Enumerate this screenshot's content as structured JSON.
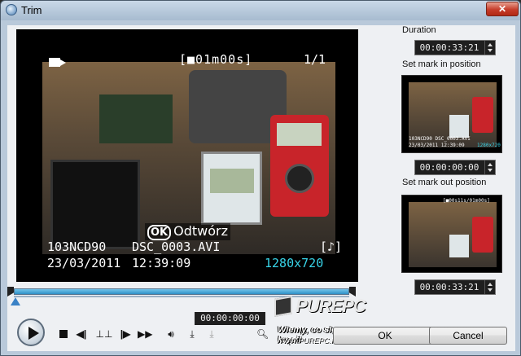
{
  "window": {
    "title": "Trim",
    "close_label": "✕"
  },
  "preview": {
    "osd_duration": "[■01m00s]",
    "osd_count": "1/1",
    "osd_play_ok": "OK",
    "osd_play_label": "Odtwórz",
    "osd_folder": "103NCD90",
    "osd_file": "DSC_0003.AVI",
    "osd_date": "23/03/2011",
    "osd_time": "12:39:09",
    "osd_note": "[♪]",
    "osd_resolution": "1280x720"
  },
  "player": {
    "timecode": "00:00:00:00",
    "progress_fraction": 0
  },
  "side_panel": {
    "duration_label": "Duration",
    "duration_value": "00:00:33:21",
    "mark_in_label": "Set mark in position",
    "mark_in_value": "00:00:00:00",
    "mark_out_label": "Set mark out position",
    "mark_out_value": "00:00:33:21",
    "thumb_in": {
      "osd_line1": "103NCD90  DSC_0003.AVI",
      "osd_line2": "23/03/2011  12:39:09",
      "osd_res": "1280x720"
    },
    "thumb_out": {
      "osd_top": "[■00s11s/01m00s]"
    }
  },
  "buttons": {
    "ok_label": "OK",
    "cancel_label": "Cancel"
  },
  "watermark": {
    "brand": "PUREPC",
    "slogan": "Wiemy, co się kręci!",
    "url": "WWW.PUREPC.PL"
  },
  "colors": {
    "accent": "#2e8fc5",
    "resolution_text": "#38d4e8",
    "close_button": "#c63c2a"
  }
}
